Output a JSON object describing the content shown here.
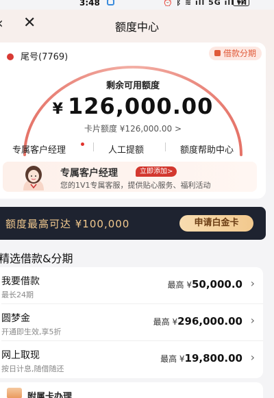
{
  "statusbar": {
    "time": "3:48",
    "icons_text": "⏰ ᛒ ≋ ıll 5G ıll ıll",
    "battery": "62"
  },
  "nav": {
    "back_icon": "‹",
    "close_icon": "✕",
    "title": "额度中心"
  },
  "card": {
    "tail": "尾号(7769)",
    "tag": "借款分期",
    "remain_label": "剩余可用额度",
    "currency": "¥",
    "amount": "126,000.00",
    "card_limit": "卡片额度 ¥126,000.00 >",
    "links": [
      "专属客户经理",
      "人工提额",
      "额度帮助中心"
    ]
  },
  "manager": {
    "title": "专属客户经理",
    "button": "立即添加>",
    "desc": "您的1V1专属客服，提供贴心服务、福利活动"
  },
  "banner": {
    "text": "额度最高可达 ¥100,000",
    "button": "申请白金卡"
  },
  "section": {
    "title": "精选借款&分期"
  },
  "loans": [
    {
      "name": "我要借款",
      "sub": "最长24期",
      "prefix": "最高 ¥",
      "value": "50,000.0"
    },
    {
      "name": "圆梦金",
      "sub": "开通即生效,享5折",
      "prefix": "最高 ¥",
      "value": "296,000.00"
    },
    {
      "name": "网上取现",
      "sub": "按日计息,随借随还",
      "prefix": "最高 ¥",
      "value": "19,800.00"
    }
  ],
  "bottom": {
    "text": "附属卡办理"
  },
  "colors": {
    "accent_red": "#d3382f",
    "gold": "#f2c98e",
    "banner_bg": "#1e2330"
  }
}
